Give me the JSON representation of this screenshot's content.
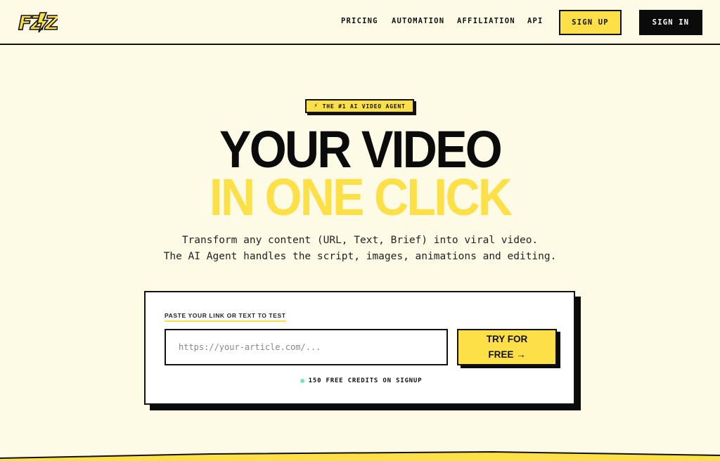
{
  "brand": {
    "logo_text": "FZ$Z"
  },
  "nav": {
    "links": [
      "PRICING",
      "AUTOMATION",
      "AFFILIATION",
      "API"
    ],
    "signup_label": "SIGN UP",
    "signin_label": "SIGN IN"
  },
  "hero": {
    "badge": "THE #1 AI VIDEO AGENT",
    "title_line1": "YOUR VIDEO",
    "title_line2": "IN ONE CLICK",
    "subtitle_line1": "Transform any content (URL, Text, Brief) into viral video.",
    "subtitle_line2": "The AI Agent handles the script, images, animations and editing."
  },
  "form": {
    "label": "PASTE YOUR LINK OR TEXT TO TEST",
    "input_placeholder": "https://your-article.com/...",
    "input_value": "",
    "button_line1": "TRY FOR",
    "button_line2": "FREE →",
    "credits_note": "150 FREE CREDITS ON SIGNUP"
  },
  "colors": {
    "background": "#fdfbe6",
    "accent_yellow": "#fde047",
    "ink": "#0b0b0b",
    "status_green": "#6ee7b7"
  }
}
